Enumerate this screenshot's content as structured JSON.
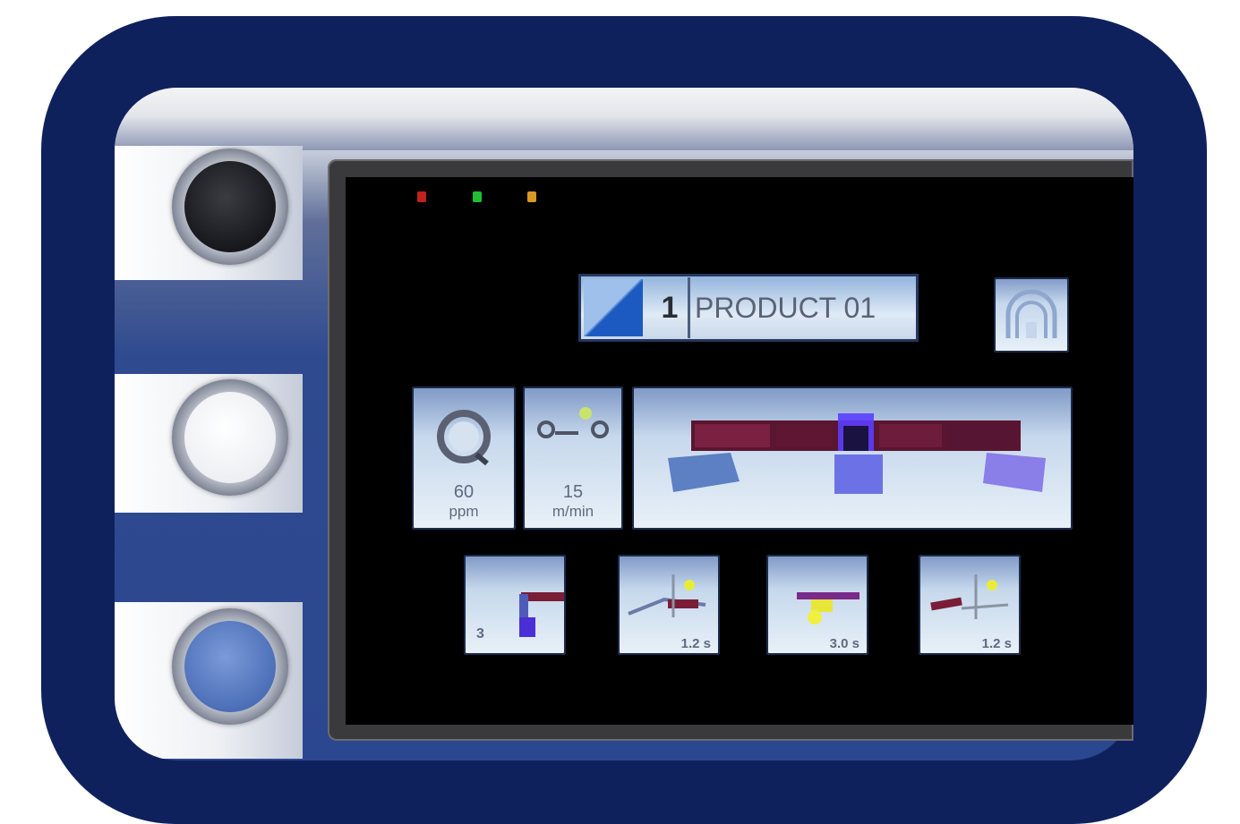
{
  "leds": {
    "red": "#c0231d",
    "green": "#1fbf33",
    "amber": "#d89a23"
  },
  "product": {
    "number": "1",
    "name": "PRODUCT 01",
    "color_swatch": "#1c5ac2"
  },
  "home_button": {
    "icon": "home-arch-icon"
  },
  "speed": {
    "value": "60",
    "unit": "ppm",
    "icon": "rotation-speed-icon"
  },
  "distance": {
    "value": "15",
    "unit": "m/min",
    "icon": "distance-icon"
  },
  "conveyor": {
    "icon": "conveyor-products-icon"
  },
  "steps": [
    {
      "value": "3",
      "icon": "push-step-icon"
    },
    {
      "value": "1.2 s",
      "icon": "lift-step-icon"
    },
    {
      "value": "3.0 s",
      "icon": "hold-step-icon"
    },
    {
      "value": "1.2 s",
      "icon": "release-step-icon"
    }
  ],
  "hardware_buttons": [
    {
      "name": "black",
      "color": "#17181c"
    },
    {
      "name": "white",
      "color": "#eceef2"
    },
    {
      "name": "blue",
      "color": "#4c6fb8"
    }
  ],
  "colors": {
    "frame": "#0f215d",
    "screen": "#000000",
    "tile_top": "#7e98c6",
    "tile_bottom": "#e9f1f8"
  }
}
